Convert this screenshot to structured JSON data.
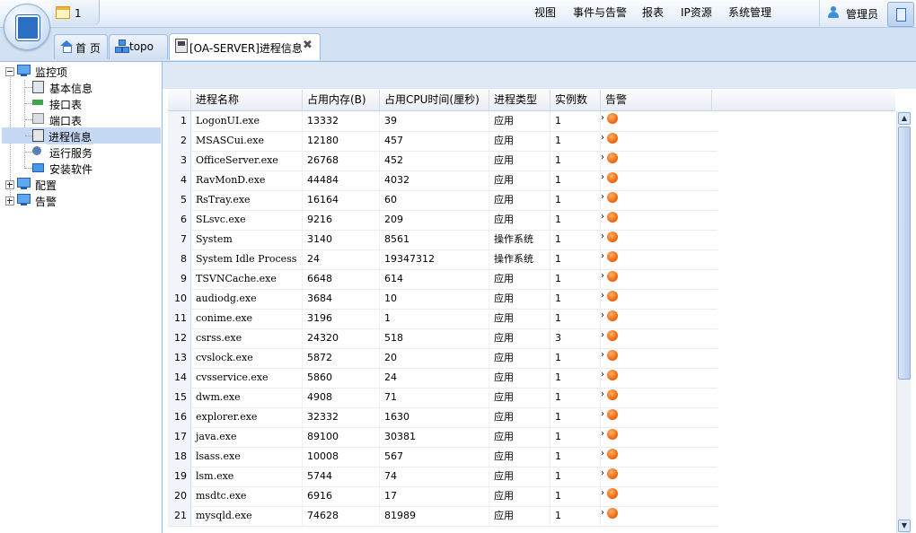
{
  "notification": {
    "count": "1"
  },
  "menu": [
    "视图",
    "事件与告警",
    "报表",
    "IP资源",
    "系统管理"
  ],
  "user": {
    "name": "管理员"
  },
  "tabs": [
    {
      "label": "首 页",
      "icon": "home-icon"
    },
    {
      "label": "topo",
      "icon": "topology-icon"
    },
    {
      "label": "[OA-SERVER]进程信息",
      "icon": "server-icon",
      "active": true,
      "closable": true
    }
  ],
  "tree": {
    "root": "监控项",
    "children": [
      "基本信息",
      "接口表",
      "端口表",
      "进程信息",
      "运行服务",
      "安装软件"
    ],
    "selected": "进程信息",
    "siblings": [
      "配置",
      "告警"
    ]
  },
  "grid": {
    "columns": [
      "进程名称",
      "占用内存(B)",
      "占用CPU时间(厘秒)",
      "进程类型",
      "实例数",
      "告警"
    ],
    "rows": [
      [
        "1",
        "LogonUI.exe",
        "13332",
        "39",
        "应用",
        "1"
      ],
      [
        "2",
        "MSASCui.exe",
        "12180",
        "457",
        "应用",
        "1"
      ],
      [
        "3",
        "OfficeServer.exe",
        "26768",
        "452",
        "应用",
        "1"
      ],
      [
        "4",
        "RavMonD.exe",
        "44484",
        "4032",
        "应用",
        "1"
      ],
      [
        "5",
        "RsTray.exe",
        "16164",
        "60",
        "应用",
        "1"
      ],
      [
        "6",
        "SLsvc.exe",
        "9216",
        "209",
        "应用",
        "1"
      ],
      [
        "7",
        "System",
        "3140",
        "8561",
        "操作系统",
        "1"
      ],
      [
        "8",
        "System Idle Process",
        "24",
        "19347312",
        "操作系统",
        "1"
      ],
      [
        "9",
        "TSVNCache.exe",
        "6648",
        "614",
        "应用",
        "1"
      ],
      [
        "10",
        "audiodg.exe",
        "3684",
        "10",
        "应用",
        "1"
      ],
      [
        "11",
        "conime.exe",
        "3196",
        "1",
        "应用",
        "1"
      ],
      [
        "12",
        "csrss.exe",
        "24320",
        "518",
        "应用",
        "3"
      ],
      [
        "13",
        "cvslock.exe",
        "5872",
        "20",
        "应用",
        "1"
      ],
      [
        "14",
        "cvsservice.exe",
        "5860",
        "24",
        "应用",
        "1"
      ],
      [
        "15",
        "dwm.exe",
        "4908",
        "71",
        "应用",
        "1"
      ],
      [
        "16",
        "explorer.exe",
        "32332",
        "1630",
        "应用",
        "1"
      ],
      [
        "17",
        "java.exe",
        "89100",
        "30381",
        "应用",
        "1"
      ],
      [
        "18",
        "lsass.exe",
        "10008",
        "567",
        "应用",
        "1"
      ],
      [
        "19",
        "lsm.exe",
        "5744",
        "74",
        "应用",
        "1"
      ],
      [
        "20",
        "msdtc.exe",
        "6916",
        "17",
        "应用",
        "1"
      ],
      [
        "21",
        "mysqld.exe",
        "74628",
        "81989",
        "应用",
        "1"
      ]
    ]
  },
  "colors": {
    "alarm": "#f26a10",
    "header_bg": "#dfeaf8",
    "selected": "#c6d9f4"
  }
}
